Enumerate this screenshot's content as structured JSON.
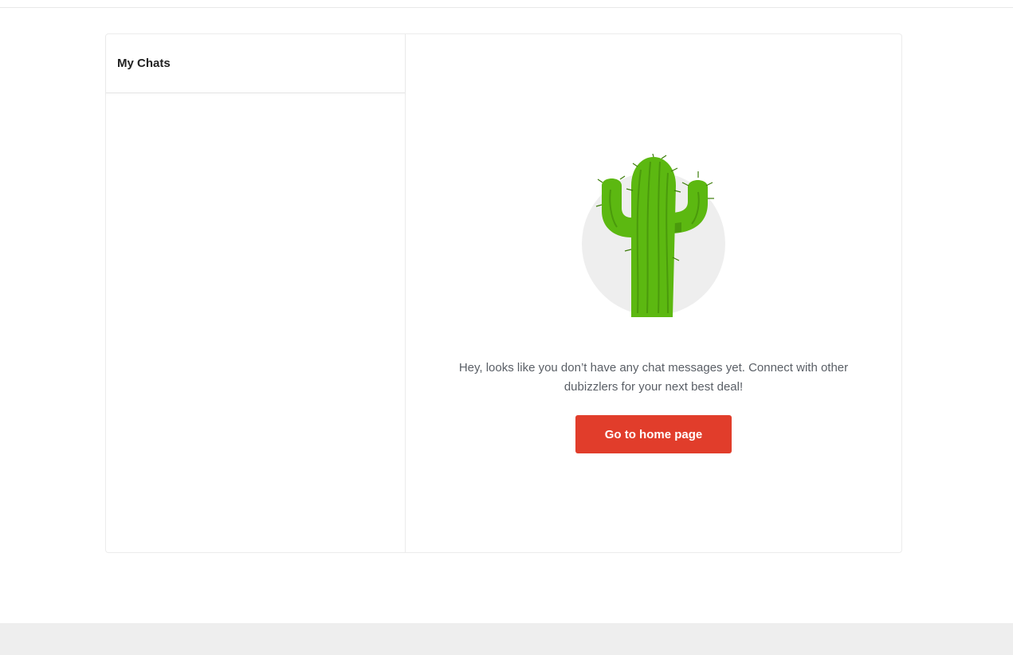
{
  "chat_list": {
    "title": "My Chats"
  },
  "empty_state": {
    "message": "Hey, looks like you don’t have any chat messages yet. Connect with other dubizzlers for your next best deal!",
    "button_label": "Go to home page",
    "illustration_icon": "cactus-icon"
  },
  "colors": {
    "accent": "#e13d2b",
    "cactus_green": "#5cb811",
    "cactus_dark": "#4a9a0c",
    "circle_bg": "#eeeeee",
    "footer_bg": "#eeeeee"
  }
}
